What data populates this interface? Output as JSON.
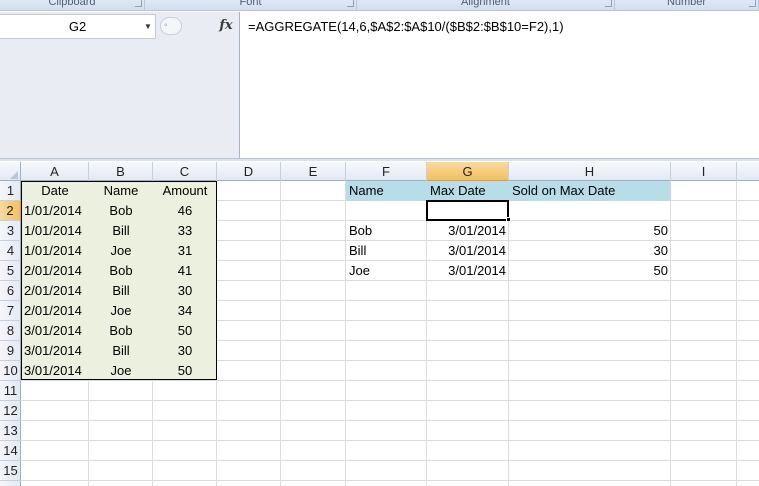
{
  "ribbon": {
    "groups": [
      {
        "label": "Clipboard"
      },
      {
        "label": "Font"
      },
      {
        "label": "Alignment"
      },
      {
        "label": "Number"
      }
    ]
  },
  "formula_bar": {
    "name_box": "G2",
    "fx_label": "fx",
    "formula": "=AGGREGATE(14,6,$A$2:$A$10/($B$2:$B$10=F2),1)"
  },
  "columns": [
    "A",
    "B",
    "C",
    "D",
    "E",
    "F",
    "G",
    "H",
    "I"
  ],
  "selected_column": "G",
  "rows": [
    "1",
    "2",
    "3",
    "4",
    "5",
    "6",
    "7",
    "8",
    "9",
    "10",
    "11",
    "12",
    "13",
    "14",
    "15"
  ],
  "selected_row": "2",
  "table1": {
    "headers": [
      "Date",
      "Name",
      "Amount"
    ],
    "rows": [
      [
        "1/01/2014",
        "Bob",
        "46"
      ],
      [
        "1/01/2014",
        "Bill",
        "33"
      ],
      [
        "1/01/2014",
        "Joe",
        "31"
      ],
      [
        "2/01/2014",
        "Bob",
        "41"
      ],
      [
        "2/01/2014",
        "Bill",
        "30"
      ],
      [
        "2/01/2014",
        "Joe",
        "34"
      ],
      [
        "3/01/2014",
        "Bob",
        "50"
      ],
      [
        "3/01/2014",
        "Bill",
        "30"
      ],
      [
        "3/01/2014",
        "Joe",
        "50"
      ]
    ]
  },
  "table2": {
    "headers": [
      "Name",
      "Max Date",
      "Sold on Max Date"
    ],
    "rows": [
      [
        "Bob",
        "3/01/2014",
        "50"
      ],
      [
        "Bill",
        "3/01/2014",
        "30"
      ],
      [
        "Joe",
        "3/01/2014",
        "50"
      ]
    ]
  },
  "colors": {
    "table1_fill": "#ebf1de",
    "table2_header_fill": "#b7dee8",
    "selected_header": "#f9d99f"
  }
}
